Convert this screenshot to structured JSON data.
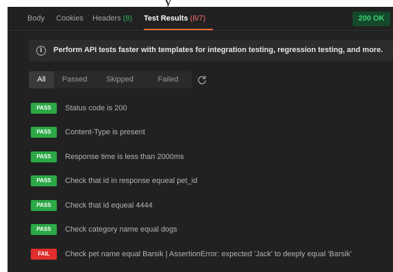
{
  "tabs": [
    {
      "label": "Body",
      "count": ""
    },
    {
      "label": "Cookies",
      "count": ""
    },
    {
      "label": "Headers",
      "count": "(8)"
    },
    {
      "label": "Test Results",
      "count": "(6/7)"
    }
  ],
  "active_tab": "Test Results",
  "response_status": "200 OK",
  "banner": {
    "icon": "info-icon",
    "text": "Perform API tests faster with templates for integration testing, regression testing, and more."
  },
  "filters": [
    "All",
    "Passed",
    "Skipped",
    "Failed"
  ],
  "active_filter": "All",
  "results": [
    {
      "status": "PASS",
      "name": "Status code is 200"
    },
    {
      "status": "PASS",
      "name": "Content-Type is present"
    },
    {
      "status": "PASS",
      "name": "Response time is less than 2000ms"
    },
    {
      "status": "PASS",
      "name": "Check that id in response equeal pet_id"
    },
    {
      "status": "PASS",
      "name": "Check that id equeal 4444"
    },
    {
      "status": "PASS",
      "name": "Check category name equal dogs"
    },
    {
      "status": "FAIL",
      "name": "Check pet name equal Barsik | AssertionError: expected 'Jack' to deeply equal 'Barsik'"
    }
  ],
  "colors": {
    "pass": "#2ca847",
    "fail": "#e02d2d",
    "accent": "#ff6c37",
    "status_ok": "#3ecf74"
  }
}
